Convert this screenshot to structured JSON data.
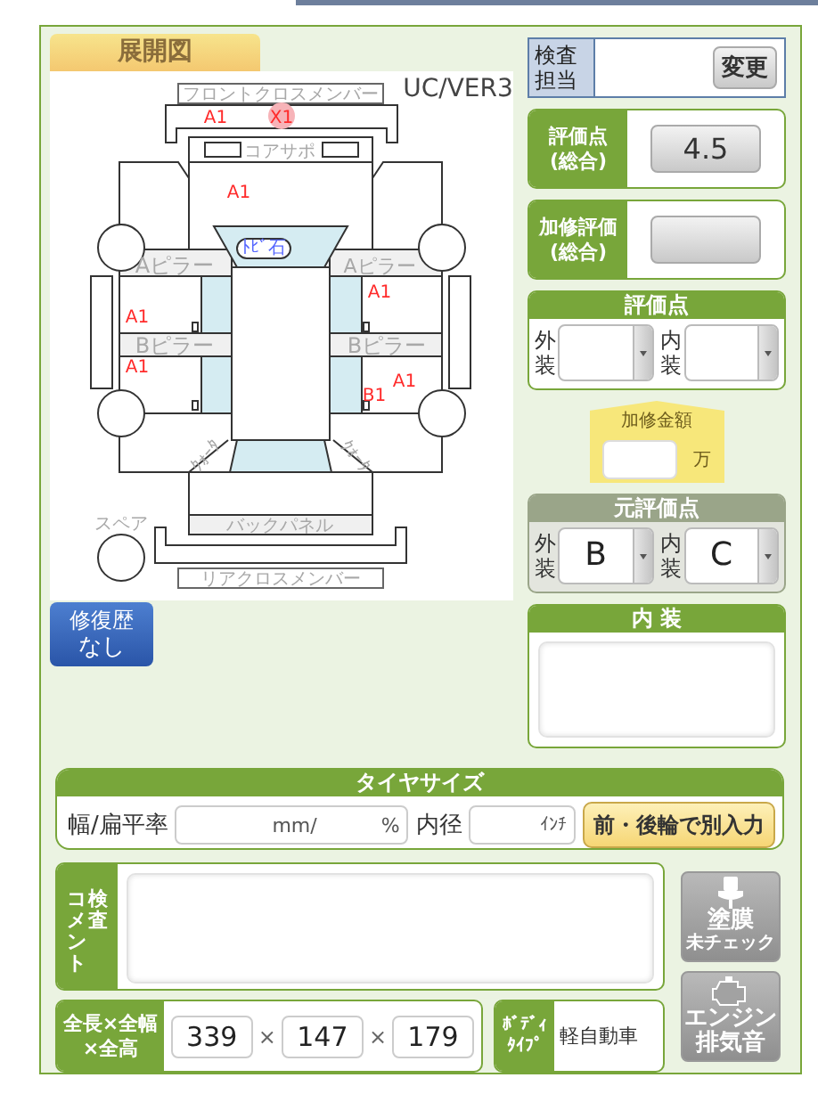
{
  "diagram": {
    "tab": "展開図",
    "version": "UC/VER3",
    "parts": [
      "フロントクロスメンバー",
      "コアサポ",
      "Aピラー",
      "Aピラー",
      "ﾄﾋﾞ石",
      "Bピラー",
      "Bピラー",
      "ｸｫｰﾀ",
      "ｸｫｰﾀ",
      "スペア",
      "バックパネル",
      "リアクロスメンバー"
    ],
    "marks": [
      {
        "code": "A1",
        "selected": false
      },
      {
        "code": "X1",
        "selected": true
      },
      {
        "code": "A1",
        "selected": false
      },
      {
        "code": "A1",
        "selected": false
      },
      {
        "code": "A1",
        "selected": false
      },
      {
        "code": "A1",
        "selected": false
      },
      {
        "code": "A1",
        "selected": false
      },
      {
        "code": "B1",
        "selected": false
      }
    ]
  },
  "repair_history": {
    "label": "修復歴",
    "value": "なし"
  },
  "inspector": {
    "label": "検査担当",
    "button": "変更"
  },
  "overall_score": {
    "label": "評価点\n(総合)",
    "value": "4.5"
  },
  "repair_score": {
    "label": "加修評価\n(総合)"
  },
  "score": {
    "title": "評価点",
    "fields": [
      {
        "label": "外装"
      },
      {
        "label": "内装"
      }
    ]
  },
  "repair_cost": {
    "label": "加修金額",
    "unit": "万"
  },
  "original_score": {
    "title": "元評価点",
    "fields": [
      {
        "label": "外装",
        "value": "B"
      },
      {
        "label": "内装",
        "value": "C"
      }
    ]
  },
  "interior": {
    "title": "内 装"
  },
  "tire": {
    "title": "タイヤサイズ",
    "width_label": "幅/扁平率",
    "width_unit": "mm/",
    "ratio_unit": "%",
    "diameter_label": "内径",
    "diameter_unit": "ｲﾝﾁ",
    "button": "前・後輪で別入力"
  },
  "comment": {
    "label": [
      "コメント",
      "検査"
    ]
  },
  "dimensions": {
    "label": "全長×全幅\n×全高",
    "values": [
      "339",
      "147",
      "179"
    ],
    "separators": [
      "×",
      "×"
    ]
  },
  "body_type": {
    "label": "ﾎﾞﾃﾞｨﾀｲﾌﾟ",
    "value": "軽自動車"
  },
  "side_buttons": [
    {
      "kind": "paint",
      "lines": [
        "塗膜",
        "未チェック"
      ]
    },
    {
      "kind": "engine",
      "lines": [
        "エンジン",
        "排気音"
      ]
    }
  ]
}
